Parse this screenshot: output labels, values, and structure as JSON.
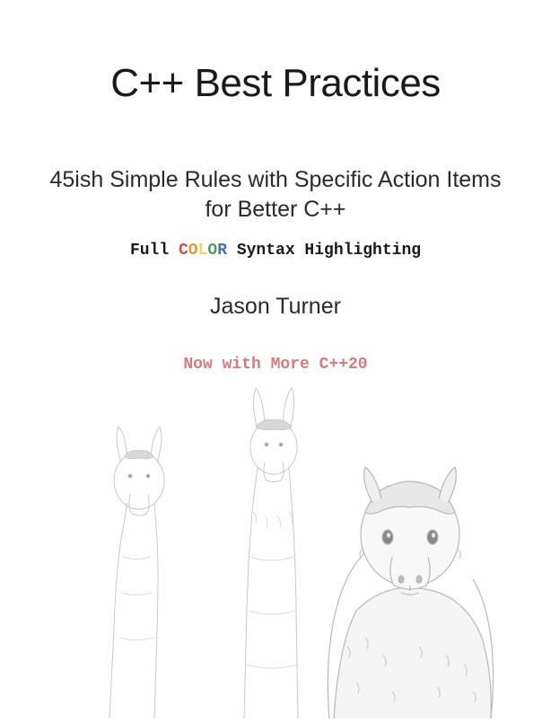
{
  "title": "C++ Best Practices",
  "subtitle_line1": "45ish Simple Rules with Specific Action Items",
  "subtitle_line2": "for Better C++",
  "highlight_prefix": "Full ",
  "highlight_c": "C",
  "highlight_o1": "O",
  "highlight_l": "L",
  "highlight_o2": "O",
  "highlight_r": "R",
  "highlight_suffix": " Syntax Highlighting",
  "author": "Jason Turner",
  "tagline": "Now with More C++20"
}
